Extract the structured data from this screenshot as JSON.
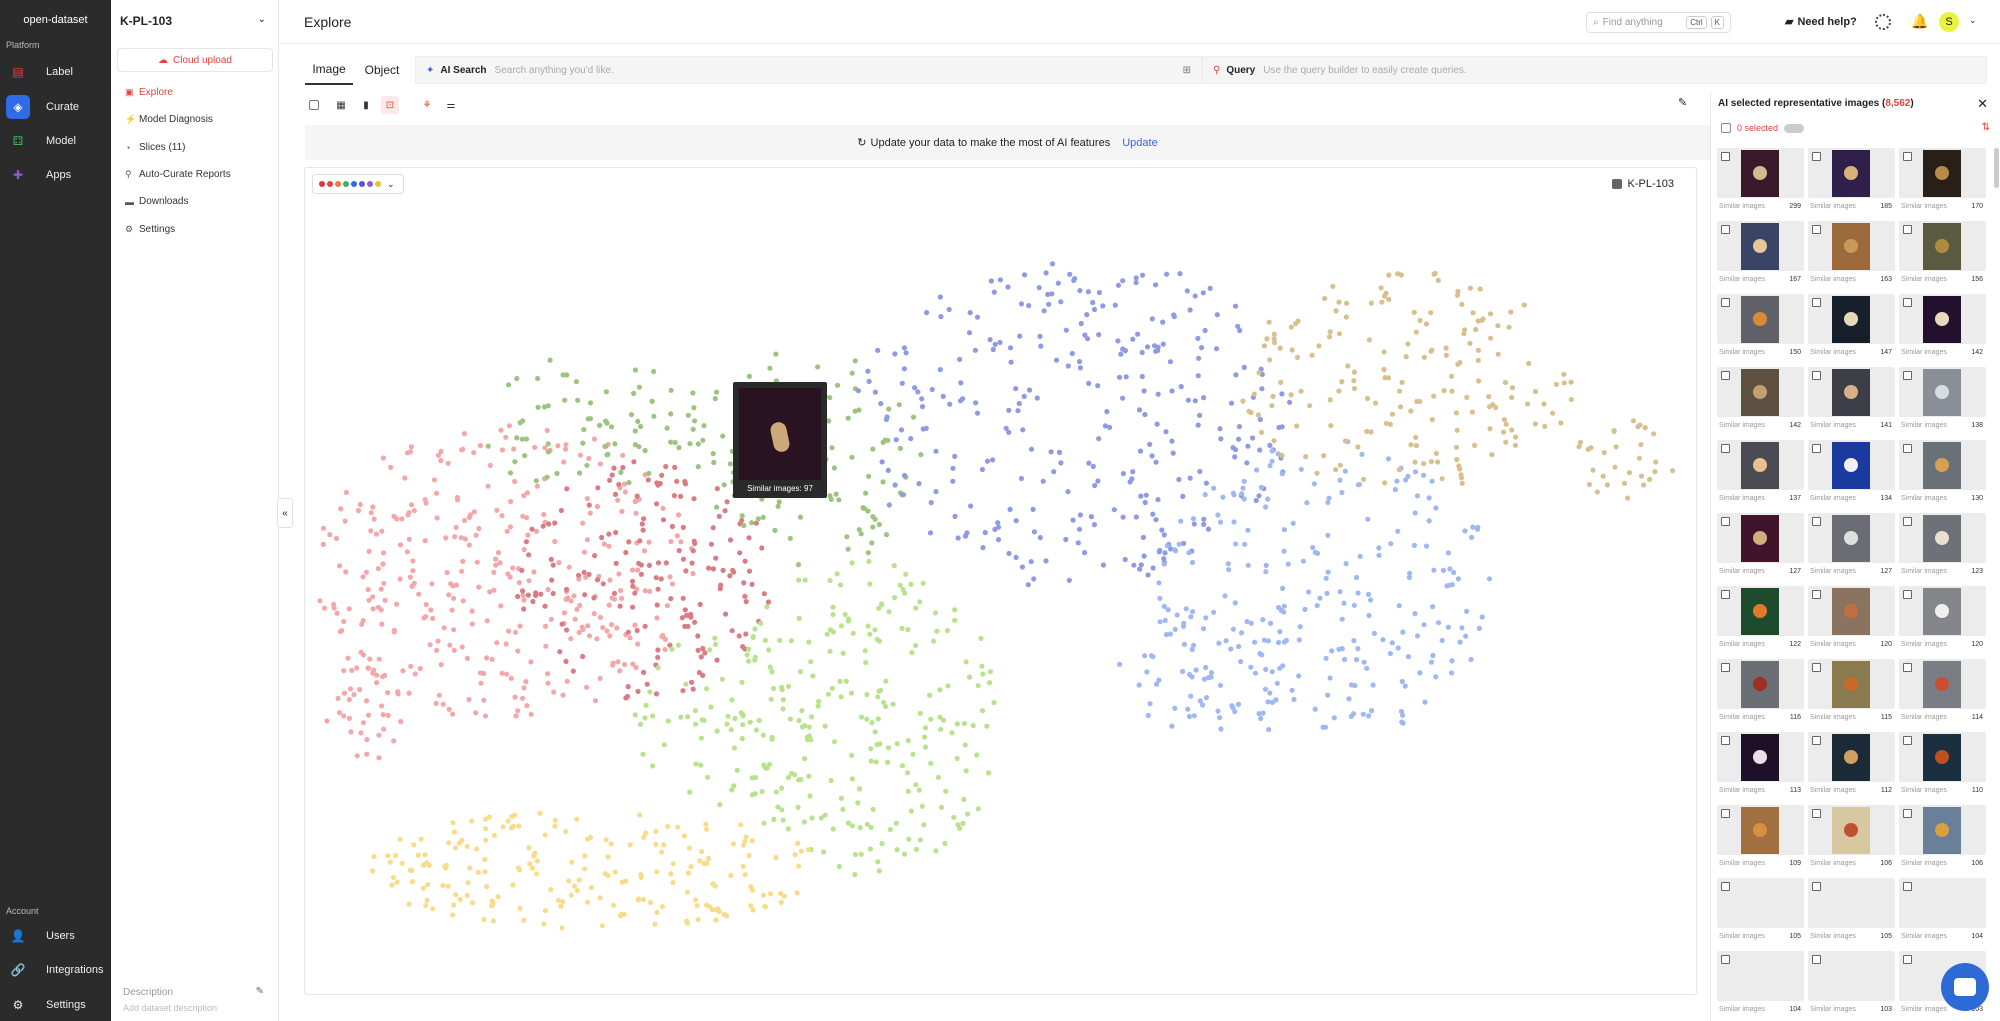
{
  "sidebar": {
    "org": "open-dataset",
    "platform_label": "Platform",
    "account_label": "Account",
    "items": [
      {
        "label": "Label",
        "icon": "label-icon",
        "color": "#e2453b"
      },
      {
        "label": "Curate",
        "icon": "curate-icon",
        "color": "#ffffff"
      },
      {
        "label": "Model",
        "icon": "model-icon",
        "color": "#3fb35a"
      },
      {
        "label": "Apps",
        "icon": "apps-icon",
        "color": "#8e5bd8"
      }
    ],
    "account_items": [
      {
        "label": "Users",
        "icon": "user-icon"
      },
      {
        "label": "Integrations",
        "icon": "link-icon"
      },
      {
        "label": "Settings",
        "icon": "gear-icon"
      }
    ]
  },
  "dataset_nav": {
    "dataset_name": "K-PL-103",
    "cloud_upload": "Cloud upload",
    "items": [
      {
        "label": "Explore",
        "icon": "explore-icon"
      },
      {
        "label": "Model Diagnosis",
        "icon": "diagnosis-icon"
      },
      {
        "label": "Slices (11)",
        "icon": "slices-icon"
      },
      {
        "label": "Auto-Curate Reports",
        "icon": "report-icon"
      },
      {
        "label": "Downloads",
        "icon": "download-icon"
      },
      {
        "label": "Settings",
        "icon": "gear-icon"
      }
    ],
    "description_label": "Description",
    "description_placeholder": "Add dataset description"
  },
  "header": {
    "title": "Explore",
    "search_placeholder": "Find anything",
    "shortcut_ctrl": "Ctrl",
    "shortcut_key": "K",
    "help": "Need help?",
    "avatar_letter": "S"
  },
  "tabs": [
    {
      "label": "Image"
    },
    {
      "label": "Object"
    }
  ],
  "ai_search": {
    "label": "AI Search",
    "placeholder": "Search anything you'd like."
  },
  "query": {
    "label": "Query",
    "placeholder": "Use the query builder to easily create queries."
  },
  "banner": {
    "text": "Update your data to make the most of AI features",
    "action": "Update"
  },
  "plot": {
    "dataset_label": "K-PL-103",
    "legend_colors": [
      "#d9393f",
      "#e2453b",
      "#f07a3a",
      "#3fb35a",
      "#2e6be6",
      "#5a50d8",
      "#8e5bd8",
      "#f2c12e"
    ],
    "cluster_colors": {
      "pink": "#f4a7a8",
      "red": "#d97c84",
      "green_dark": "#9bc47e",
      "green_light": "#b9e28c",
      "yellow": "#f7dc8a",
      "blue_dark": "#8e9ae2",
      "blue_light": "#9fb8f2",
      "tan": "#d8c08e"
    },
    "tooltip": "Similar images: 97"
  },
  "right_panel": {
    "title_prefix": "AI selected representative images (",
    "count": "8,562",
    "title_suffix": ")",
    "selected": "0 selected",
    "similar_label": "Similar images",
    "cards": [
      {
        "count": "299",
        "bg": "#3a1a2a",
        "pill": "#d8b98e"
      },
      {
        "count": "185",
        "bg": "#2f1f4a",
        "pill": "#d8b07a"
      },
      {
        "count": "170",
        "bg": "#2a1e18",
        "pill": "#b88a4a"
      },
      {
        "count": "167",
        "bg": "#3a4565",
        "pill": "#e8c89a"
      },
      {
        "count": "163",
        "bg": "#9a6a3a",
        "pill": "#c89a5a"
      },
      {
        "count": "156",
        "bg": "#5a5a40",
        "pill": "#b08a40"
      },
      {
        "count": "150",
        "bg": "#606068",
        "pill": "#d88a3a"
      },
      {
        "count": "147",
        "bg": "#16202a",
        "pill": "#e8d8b8"
      },
      {
        "count": "142",
        "bg": "#22102e",
        "pill": "#e8d8c0"
      },
      {
        "count": "142",
        "bg": "#5e5040",
        "pill": "#c0a070"
      },
      {
        "count": "141",
        "bg": "#3e3e48",
        "pill": "#d8b08a"
      },
      {
        "count": "138",
        "bg": "#8a8e96",
        "pill": "#d8dde0"
      },
      {
        "count": "137",
        "bg": "#4a4a52",
        "pill": "#e8c090"
      },
      {
        "count": "134",
        "bg": "#1a3aa0",
        "pill": "#f0f0f4"
      },
      {
        "count": "130",
        "bg": "#6a7078",
        "pill": "#d8a050"
      },
      {
        "count": "127",
        "bg": "#40142a",
        "pill": "#d0b080"
      },
      {
        "count": "127",
        "bg": "#6a6e74",
        "pill": "#e0e0e0"
      },
      {
        "count": "123",
        "bg": "#6e7278",
        "pill": "#e8e0d0"
      },
      {
        "count": "122",
        "bg": "#1e4a2e",
        "pill": "#e07a2a"
      },
      {
        "count": "120",
        "bg": "#8a7460",
        "pill": "#c07040"
      },
      {
        "count": "120",
        "bg": "#84868c",
        "pill": "#f0f0f0"
      },
      {
        "count": "116",
        "bg": "#6a6e74",
        "pill": "#a03020"
      },
      {
        "count": "115",
        "bg": "#8a7a50",
        "pill": "#c86a2a"
      },
      {
        "count": "114",
        "bg": "#7a7e84",
        "pill": "#c85030"
      },
      {
        "count": "113",
        "bg": "#1e1028",
        "pill": "#e8e0e8"
      },
      {
        "count": "112",
        "bg": "#1a2a36",
        "pill": "#d0a060"
      },
      {
        "count": "110",
        "bg": "#1a3040",
        "pill": "#c05020"
      },
      {
        "count": "109",
        "bg": "#a07040",
        "pill": "#d89040"
      },
      {
        "count": "106",
        "bg": "#d8c8a0",
        "pill": "#c05030"
      },
      {
        "count": "106",
        "bg": "#6a8098",
        "pill": "#d8a040"
      },
      {
        "count": "105",
        "bg": "",
        "pill": ""
      },
      {
        "count": "105",
        "bg": "",
        "pill": ""
      },
      {
        "count": "104",
        "bg": "",
        "pill": ""
      },
      {
        "count": "104",
        "bg": "",
        "pill": ""
      },
      {
        "count": "103",
        "bg": "",
        "pill": ""
      },
      {
        "count": "103",
        "bg": "",
        "pill": ""
      }
    ]
  }
}
